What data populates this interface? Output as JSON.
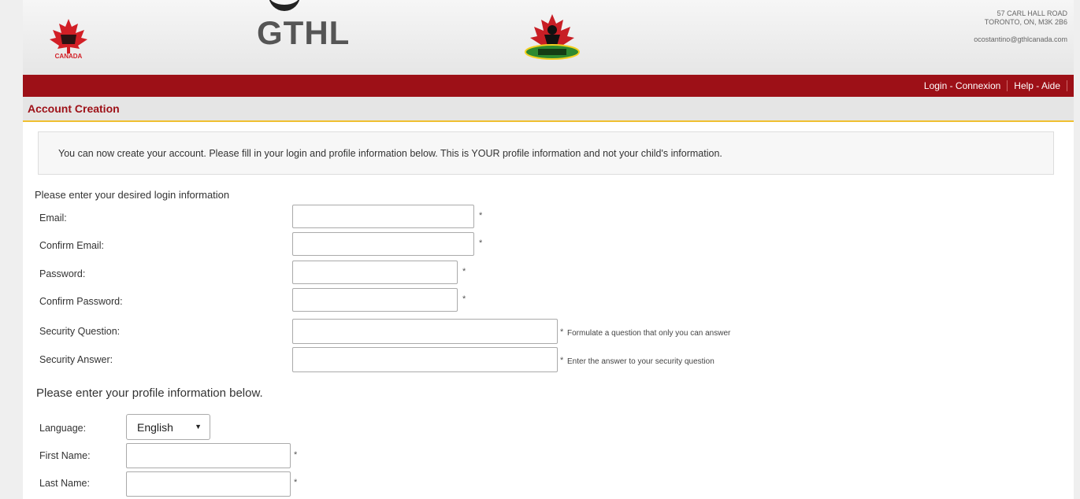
{
  "header": {
    "brand": "GTHL",
    "canada_logo_text": "CANADA",
    "address_line1": "57 CARL HALL ROAD",
    "address_line2": "TORONTO, ON, M3K 2B6",
    "contact_email": "ocostantino@gthlcanada.com"
  },
  "nav": {
    "login": "Login - Connexion",
    "help": "Help - Aide"
  },
  "page_title": "Account Creation",
  "notice": "You can now create your account. Please fill in your login and profile information below. This is YOUR profile information and not your child's information.",
  "login_section": {
    "title": "Please enter your desired login information",
    "email_label": "Email:",
    "confirm_email_label": "Confirm Email:",
    "password_label": "Password:",
    "confirm_password_label": "Confirm Password:",
    "security_question_label": "Security Question:",
    "security_question_hint": "Formulate a question that only you can answer",
    "security_answer_label": "Security Answer:",
    "security_answer_hint": "Enter the answer to your security question",
    "required_mark": "*"
  },
  "profile_section": {
    "title": "Please enter your profile information below.",
    "language_label": "Language:",
    "language_value": "English",
    "first_name_label": "First Name:",
    "last_name_label": "Last Name:"
  },
  "colors": {
    "navbar": "#9d1017",
    "title_red": "#9d1017",
    "accent_yellow": "#f0c030"
  }
}
